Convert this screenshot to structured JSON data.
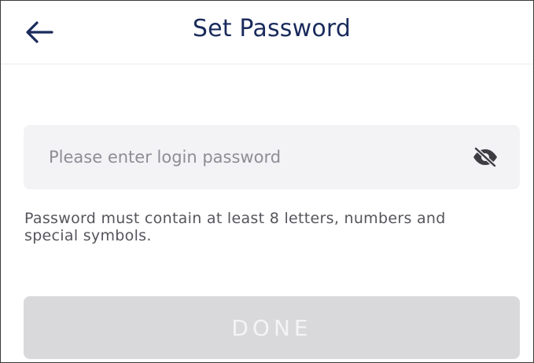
{
  "header": {
    "title": "Set Password",
    "back_icon": "arrow-left-icon"
  },
  "password_field": {
    "value": "",
    "placeholder": "Please enter login password",
    "visibility_icon": "eye-off-icon"
  },
  "hint": {
    "text": "Password must contain at least 8 letters, numbers and special symbols."
  },
  "done_button": {
    "label": "DONE",
    "state": "disabled"
  },
  "colors": {
    "title": "#1a2b5c",
    "field_background": "#f3f3f6",
    "button_disabled": "#d9d9dc"
  }
}
